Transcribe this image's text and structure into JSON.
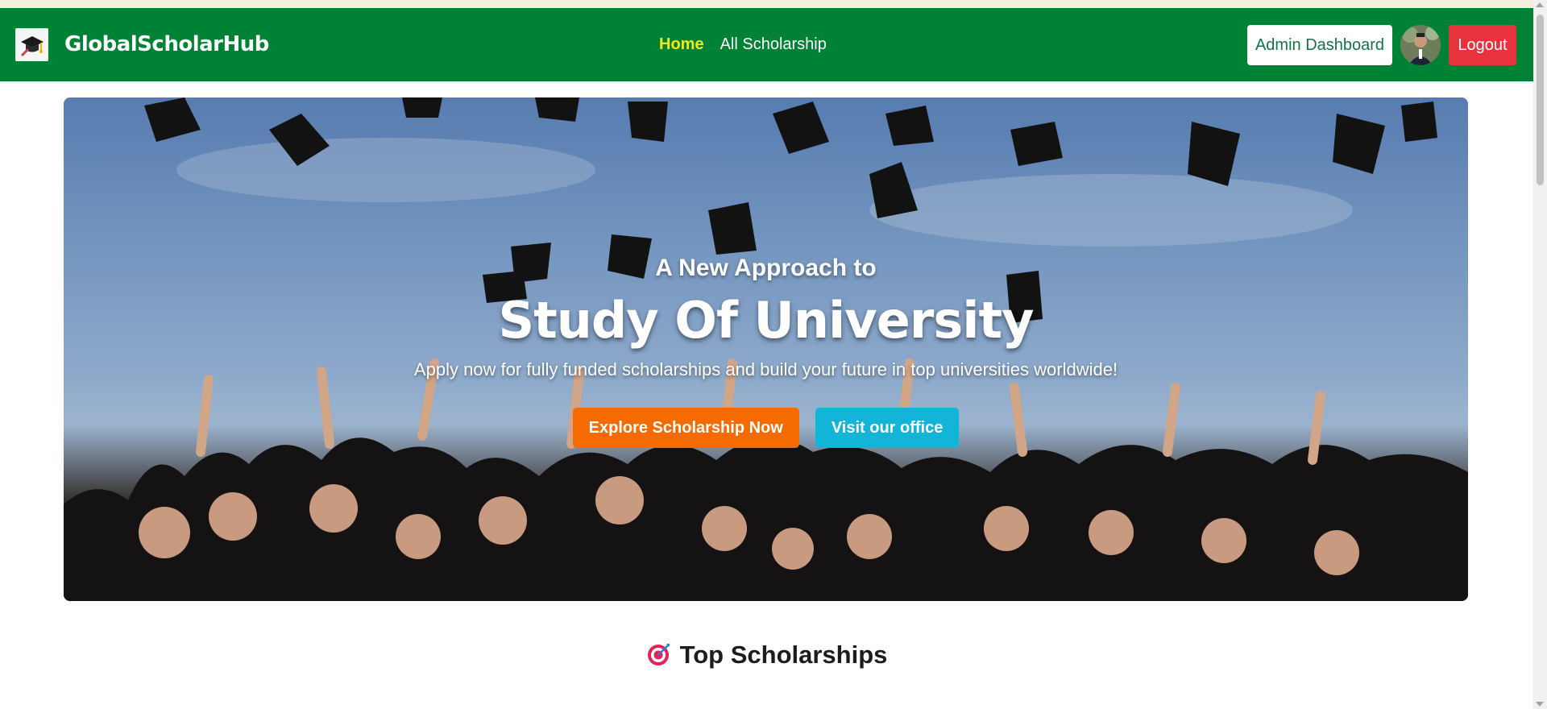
{
  "navbar": {
    "brand": "GlobalScholarHub",
    "links": [
      {
        "label": "Home",
        "active": true
      },
      {
        "label": "All Scholarship",
        "active": false
      }
    ],
    "admin_label": "Admin Dashboard",
    "logout_label": "Logout",
    "logo_icon": "graduation-cap-icon"
  },
  "hero": {
    "kicker": "A New Approach to",
    "title": "Study Of University",
    "subtitle": "Apply now for fully funded scholarships and build your future in top universities worldwide!",
    "explore_label": "Explore Scholarship Now",
    "office_label": "Visit our office"
  },
  "section": {
    "title": "Top Scholarships",
    "icon": "target-icon"
  },
  "colors": {
    "navbar": "#008236",
    "active_link": "#f5e71f",
    "explore": "#f66b00",
    "office": "#12b5d8",
    "logout": "#e8333f"
  }
}
